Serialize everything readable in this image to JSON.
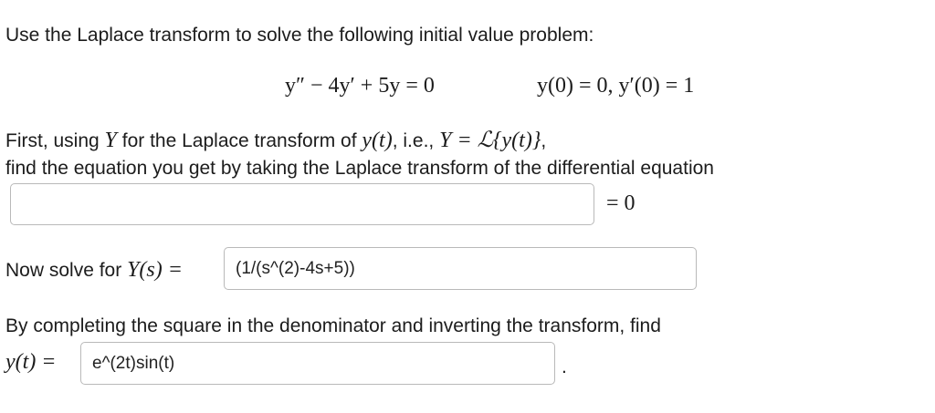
{
  "problem": {
    "intro": "Use the Laplace transform to solve the following initial value problem:",
    "equation": "y″ − 4y′ + 5y = 0",
    "initial_conditions": "y(0) = 0,  y′(0) = 1"
  },
  "step1": {
    "line1_text": "First, using",
    "line1_math_Y": "Y",
    "line1_mid": "for the Laplace transform of",
    "line1_math_yt": "y(t)",
    "line1_ie": ", i.e.,",
    "line1_math_def": "Y = ℒ{y(t)}",
    "line1_end": ",",
    "line2": "find the equation you get by taking the Laplace transform of the differential equation",
    "answer_value": "",
    "rhs": "= 0"
  },
  "step2": {
    "label_text": "Now solve for",
    "label_math": "Y(s) =",
    "answer_value": "(1/(s^(2)-4s+5))"
  },
  "step3": {
    "text": "By completing the square in the denominator and inverting the transform, find",
    "label_math": "y(t) =",
    "answer_value": "e^(2t)sin(t)",
    "period": "."
  }
}
